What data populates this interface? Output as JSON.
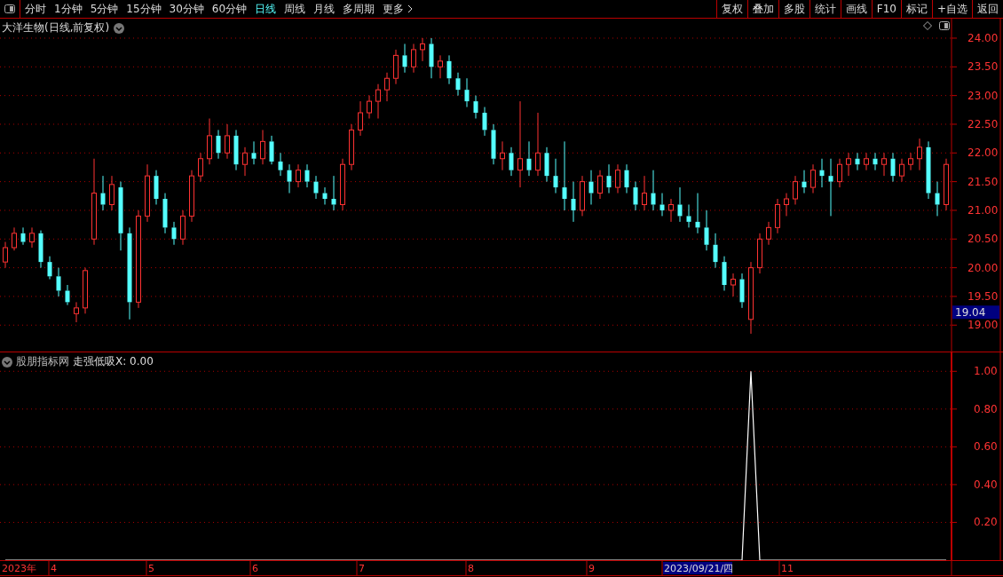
{
  "toolbar": {
    "periods": [
      {
        "label": "分时",
        "selected": false
      },
      {
        "label": "1分钟",
        "selected": false
      },
      {
        "label": "5分钟",
        "selected": false
      },
      {
        "label": "15分钟",
        "selected": false
      },
      {
        "label": "30分钟",
        "selected": false
      },
      {
        "label": "60分钟",
        "selected": false
      },
      {
        "label": "日线",
        "selected": true
      },
      {
        "label": "周线",
        "selected": false
      },
      {
        "label": "月线",
        "selected": false
      },
      {
        "label": "多周期",
        "selected": false
      },
      {
        "label": "更多",
        "selected": false
      }
    ],
    "actions": [
      "复权",
      "叠加",
      "多股",
      "统计",
      "画线",
      "F10",
      "标记",
      "+自选",
      "返回"
    ]
  },
  "price_chart": {
    "title": "大洋生物(日线,前复权)",
    "current_price": "19.04",
    "chart_data": {
      "type": "candlestick",
      "ylim": [
        18.54,
        24.34
      ],
      "grid": true,
      "yticks": [
        {
          "value": 24,
          "label": "24.00"
        },
        {
          "value": 23.5,
          "label": "23.50"
        },
        {
          "value": 23,
          "label": "23.00"
        },
        {
          "value": 22.5,
          "label": "22.50"
        },
        {
          "value": 22,
          "label": "22.00"
        },
        {
          "value": 21.5,
          "label": "21.50"
        },
        {
          "value": 21,
          "label": "21.00"
        },
        {
          "value": 20.5,
          "label": "20.50"
        },
        {
          "value": 20,
          "label": "20.00"
        },
        {
          "value": 19.5,
          "label": "19.50"
        },
        {
          "value": 19,
          "label": "19.00"
        }
      ],
      "ohlc": [
        [
          20.1,
          20.45,
          20.0,
          20.35
        ],
        [
          20.35,
          20.7,
          20.3,
          20.6
        ],
        [
          20.6,
          20.7,
          20.4,
          20.45
        ],
        [
          20.45,
          20.7,
          20.35,
          20.6
        ],
        [
          20.6,
          20.65,
          20.0,
          20.1
        ],
        [
          20.1,
          20.2,
          19.8,
          19.85
        ],
        [
          19.85,
          20.0,
          19.5,
          19.6
        ],
        [
          19.6,
          19.7,
          19.35,
          19.4
        ],
        [
          19.2,
          19.4,
          19.05,
          19.3
        ],
        [
          19.3,
          20.0,
          19.2,
          19.95
        ],
        [
          20.5,
          21.9,
          20.4,
          21.3
        ],
        [
          21.3,
          21.6,
          21.0,
          21.1
        ],
        [
          21.1,
          21.6,
          21.0,
          21.45
        ],
        [
          21.4,
          21.5,
          20.3,
          20.6
        ],
        [
          20.6,
          20.7,
          19.1,
          19.4
        ],
        [
          19.4,
          21.0,
          19.3,
          20.9
        ],
        [
          20.9,
          21.8,
          20.8,
          21.6
        ],
        [
          21.6,
          21.7,
          21.1,
          21.2
        ],
        [
          21.2,
          21.3,
          20.6,
          20.7
        ],
        [
          20.7,
          20.8,
          20.4,
          20.5
        ],
        [
          20.5,
          21.0,
          20.4,
          20.9
        ],
        [
          20.9,
          21.7,
          20.8,
          21.6
        ],
        [
          21.6,
          22.0,
          21.5,
          21.9
        ],
        [
          21.9,
          22.6,
          21.8,
          22.3
        ],
        [
          22.3,
          22.4,
          21.9,
          22.0
        ],
        [
          22.0,
          22.5,
          21.9,
          22.3
        ],
        [
          22.3,
          22.4,
          21.7,
          21.8
        ],
        [
          21.8,
          22.1,
          21.6,
          22.0
        ],
        [
          22.0,
          22.2,
          21.8,
          21.9
        ],
        [
          21.9,
          22.4,
          21.8,
          22.2
        ],
        [
          22.2,
          22.3,
          21.8,
          21.85
        ],
        [
          21.85,
          22.0,
          21.6,
          21.7
        ],
        [
          21.7,
          21.8,
          21.3,
          21.5
        ],
        [
          21.5,
          21.8,
          21.4,
          21.7
        ],
        [
          21.7,
          21.8,
          21.4,
          21.5
        ],
        [
          21.5,
          21.6,
          21.2,
          21.3
        ],
        [
          21.3,
          21.4,
          21.1,
          21.2
        ],
        [
          21.2,
          21.6,
          21.0,
          21.1
        ],
        [
          21.1,
          21.9,
          21.0,
          21.8
        ],
        [
          21.8,
          22.5,
          21.7,
          22.4
        ],
        [
          22.4,
          22.9,
          22.3,
          22.7
        ],
        [
          22.7,
          23.0,
          22.6,
          22.9
        ],
        [
          22.9,
          23.2,
          22.6,
          23.1
        ],
        [
          23.1,
          23.4,
          22.9,
          23.3
        ],
        [
          23.3,
          23.8,
          23.2,
          23.7
        ],
        [
          23.7,
          23.9,
          23.4,
          23.5
        ],
        [
          23.5,
          23.9,
          23.4,
          23.8
        ],
        [
          23.8,
          24.0,
          23.6,
          23.9
        ],
        [
          23.9,
          24.0,
          23.3,
          23.5
        ],
        [
          23.5,
          23.7,
          23.3,
          23.6
        ],
        [
          23.6,
          23.7,
          23.2,
          23.3
        ],
        [
          23.3,
          23.4,
          23.0,
          23.1
        ],
        [
          23.1,
          23.3,
          22.8,
          22.9
        ],
        [
          22.9,
          23.0,
          22.6,
          22.7
        ],
        [
          22.7,
          22.8,
          22.3,
          22.4
        ],
        [
          22.4,
          22.5,
          21.8,
          21.9
        ],
        [
          21.9,
          22.2,
          21.7,
          22.0
        ],
        [
          22.0,
          22.1,
          21.6,
          21.7
        ],
        [
          21.7,
          22.9,
          21.4,
          21.9
        ],
        [
          21.9,
          22.2,
          21.6,
          21.7
        ],
        [
          21.7,
          22.7,
          21.6,
          22.0
        ],
        [
          22.0,
          22.1,
          21.5,
          21.6
        ],
        [
          21.6,
          21.9,
          21.3,
          21.4
        ],
        [
          21.4,
          22.2,
          21.0,
          21.2
        ],
        [
          21.2,
          21.5,
          20.8,
          21.0
        ],
        [
          21.0,
          21.6,
          20.9,
          21.5
        ],
        [
          21.5,
          21.7,
          21.1,
          21.3
        ],
        [
          21.3,
          21.7,
          21.2,
          21.6
        ],
        [
          21.6,
          21.8,
          21.3,
          21.4
        ],
        [
          21.4,
          21.8,
          21.3,
          21.7
        ],
        [
          21.7,
          21.8,
          21.3,
          21.4
        ],
        [
          21.4,
          21.5,
          21.0,
          21.1
        ],
        [
          21.1,
          21.6,
          21.0,
          21.3
        ],
        [
          21.3,
          21.7,
          21.0,
          21.1
        ],
        [
          21.1,
          21.3,
          20.9,
          21.0
        ],
        [
          21.0,
          21.2,
          20.8,
          21.1
        ],
        [
          21.1,
          21.4,
          20.8,
          20.9
        ],
        [
          20.9,
          21.1,
          20.7,
          20.8
        ],
        [
          20.8,
          21.3,
          20.6,
          20.7
        ],
        [
          20.7,
          21.0,
          20.3,
          20.4
        ],
        [
          20.4,
          20.6,
          20.0,
          20.1
        ],
        [
          20.1,
          20.2,
          19.6,
          19.7
        ],
        [
          19.7,
          19.9,
          19.5,
          19.8
        ],
        [
          19.8,
          19.9,
          19.3,
          19.4
        ],
        [
          19.1,
          20.1,
          18.85,
          20.0
        ],
        [
          20.0,
          20.6,
          19.9,
          20.5
        ],
        [
          20.5,
          20.8,
          20.4,
          20.7
        ],
        [
          20.7,
          21.2,
          20.6,
          21.1
        ],
        [
          21.1,
          21.3,
          20.9,
          21.2
        ],
        [
          21.2,
          21.6,
          21.1,
          21.5
        ],
        [
          21.5,
          21.7,
          21.3,
          21.4
        ],
        [
          21.4,
          21.8,
          21.3,
          21.7
        ],
        [
          21.7,
          21.9,
          21.4,
          21.6
        ],
        [
          21.6,
          21.9,
          20.9,
          21.5
        ],
        [
          21.5,
          21.9,
          21.4,
          21.8
        ],
        [
          21.8,
          22.0,
          21.6,
          21.9
        ],
        [
          21.9,
          22.0,
          21.7,
          21.8
        ],
        [
          21.8,
          22.0,
          21.7,
          21.9
        ],
        [
          21.9,
          22.0,
          21.7,
          21.8
        ],
        [
          21.8,
          22.0,
          21.6,
          21.9
        ],
        [
          21.9,
          22.0,
          21.5,
          21.6
        ],
        [
          21.6,
          21.9,
          21.5,
          21.8
        ],
        [
          21.8,
          22.0,
          21.7,
          21.9
        ],
        [
          21.9,
          22.25,
          21.7,
          22.1
        ],
        [
          22.1,
          22.2,
          21.2,
          21.3
        ],
        [
          21.3,
          21.5,
          20.9,
          21.1
        ],
        [
          21.1,
          21.9,
          21.0,
          21.8
        ]
      ]
    }
  },
  "indicator": {
    "source": "股朋指标网",
    "formula": "走强低吸X: 0.00",
    "chart_data": {
      "type": "line",
      "ylim": [
        0,
        1.1
      ],
      "grid": true,
      "yticks": [
        {
          "value": 0.2,
          "label": "0.20"
        },
        {
          "value": 0.4,
          "label": "0.40"
        },
        {
          "value": 0.6,
          "label": "0.60"
        },
        {
          "value": 0.8,
          "label": "0.80"
        },
        {
          "value": 1,
          "label": "1.00"
        }
      ],
      "series": [
        {
          "color": "#ffffff",
          "values": [
            0,
            0,
            0,
            0,
            0,
            0,
            0,
            0,
            0,
            0,
            0,
            0,
            0,
            0,
            0,
            0,
            0,
            0,
            0,
            0,
            0,
            0,
            0,
            0,
            0,
            0,
            0,
            0,
            0,
            0,
            0,
            0,
            0,
            0,
            0,
            0,
            0,
            0,
            0,
            0,
            0,
            0,
            0,
            0,
            0,
            0,
            0,
            0,
            0,
            0,
            0,
            0,
            0,
            0,
            0,
            0,
            0,
            0,
            0,
            0,
            0,
            0,
            0,
            0,
            0,
            0,
            0,
            0,
            0,
            0,
            0,
            0,
            0,
            0,
            0,
            0,
            0,
            0,
            0,
            0,
            0,
            0,
            0,
            0,
            1,
            0,
            0,
            0,
            0,
            0,
            0,
            0,
            0,
            0,
            0,
            0,
            0,
            0,
            0,
            0,
            0,
            0,
            0,
            0,
            0,
            0,
            0
          ]
        }
      ]
    }
  },
  "date_axis": {
    "labels": [
      {
        "text": "2023年",
        "highlighted": false
      },
      {
        "text": "4",
        "highlighted": false
      },
      {
        "text": "5",
        "highlighted": false
      },
      {
        "text": "6",
        "highlighted": false
      },
      {
        "text": "7",
        "highlighted": false
      },
      {
        "text": "8",
        "highlighted": false
      },
      {
        "text": "9",
        "highlighted": false
      },
      {
        "text": "2023/09/21/四",
        "highlighted": true
      },
      {
        "text": "11",
        "highlighted": false
      }
    ]
  }
}
